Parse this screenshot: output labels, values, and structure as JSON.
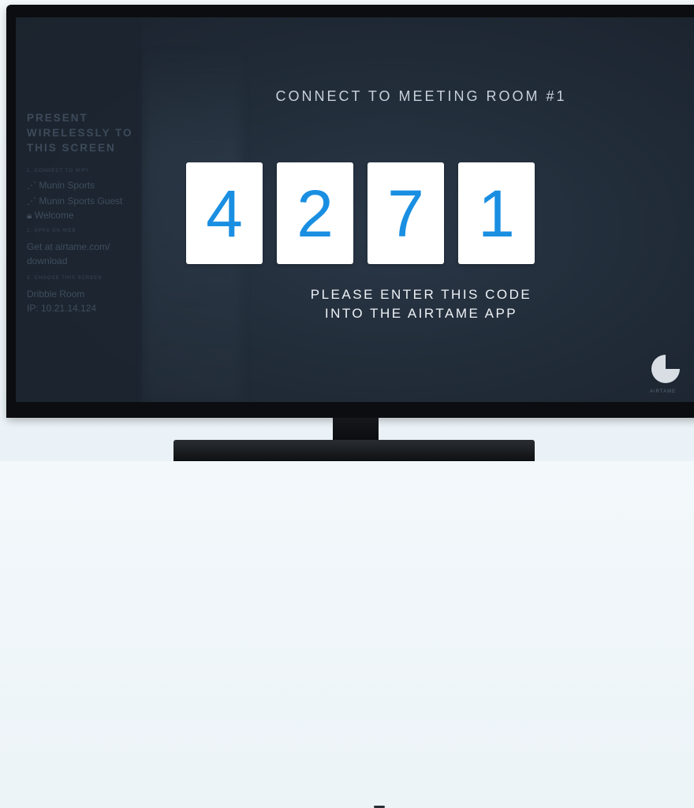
{
  "sidebar": {
    "title": [
      "PRESENT",
      "WIRELESSLY TO",
      "THIS SCREEN"
    ],
    "step1_label": "1. CONNECT TO WIFI",
    "wifi": [
      "Munin Sports",
      "Munin Sports Guest",
      "Welcome"
    ],
    "step2_label": "2. APPS ON WEB",
    "download": [
      "Get at airtame.com/",
      "download"
    ],
    "step3_label": "3. CHOOSE THIS SCREEN",
    "device": [
      "Dribble Room",
      "IP: 10.21.14.124"
    ]
  },
  "main": {
    "headline": "CONNECT TO MEETING ROOM #1",
    "code_digits": [
      "4",
      "2",
      "7",
      "1"
    ],
    "instruction": [
      "PLEASE ENTER THIS CODE",
      "INTO THE AIRTAME APP"
    ]
  },
  "brand": {
    "logo_text": "AIRTAME",
    "accent_color": "#1a8fe2",
    "icon": "airtame-logo-icon"
  }
}
